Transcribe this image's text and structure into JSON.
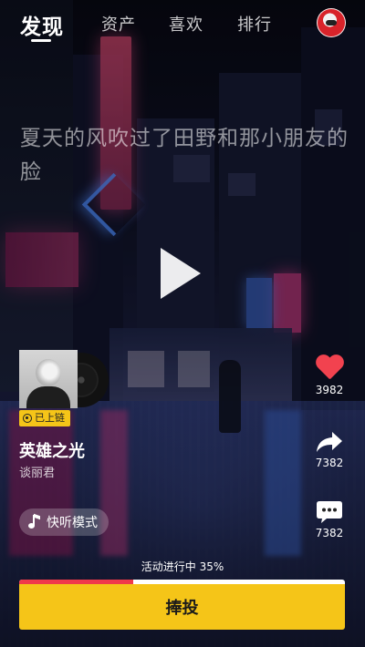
{
  "nav": {
    "tabs": [
      {
        "label": "发现",
        "active": true
      },
      {
        "label": "资产",
        "active": false
      },
      {
        "label": "喜欢",
        "active": false
      },
      {
        "label": "排行",
        "active": false
      }
    ]
  },
  "lyric": {
    "text": "夏天的风吹过了田野和那小朋友的脸"
  },
  "song": {
    "title": "英雄之光",
    "artist": "谈丽君",
    "badge": "已上链"
  },
  "actions": {
    "like_count": "3982",
    "share_count": "7382",
    "comment_count": "7382"
  },
  "quick_listen": {
    "label": "快听模式"
  },
  "campaign": {
    "status_text": "活动进行中 35%",
    "progress": 0.35,
    "button_label": "捧投"
  },
  "colors": {
    "accent_yellow": "#f5c518",
    "progress_red": "#f03a4a",
    "heart_red": "#f2424f"
  },
  "icons": [
    "play-icon",
    "heart-icon",
    "share-icon",
    "comment-icon",
    "music-note-icon",
    "chain-icon"
  ]
}
